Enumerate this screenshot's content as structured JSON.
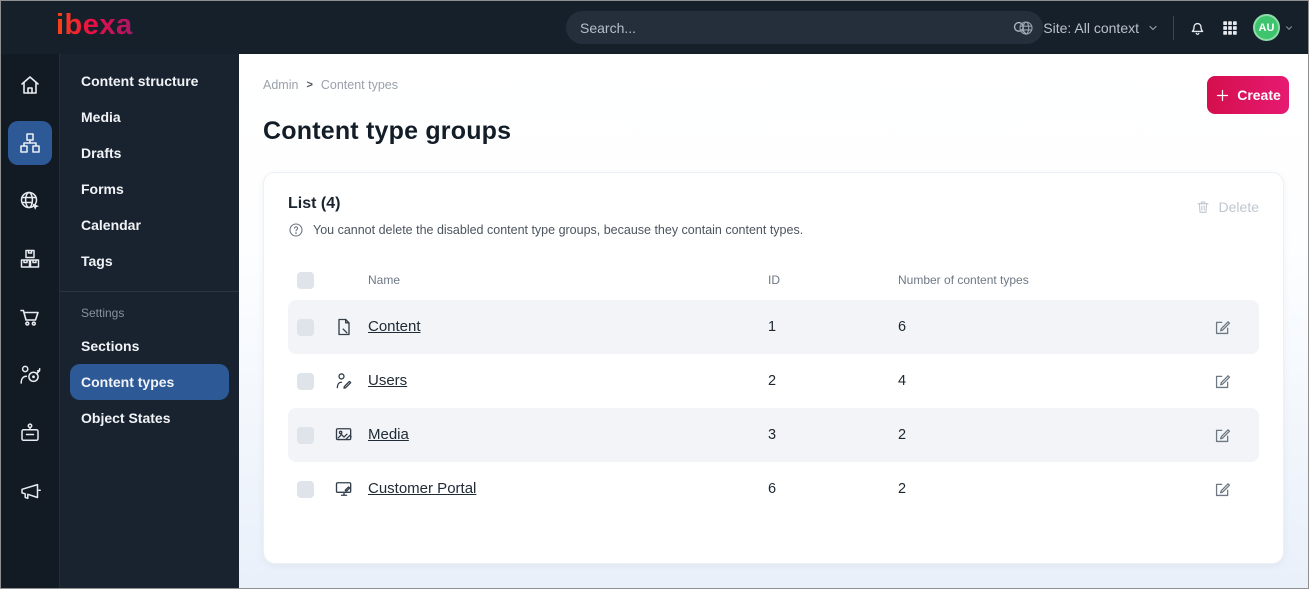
{
  "topbar": {
    "logo_text": "ibexa",
    "search": {
      "placeholder": "Search...",
      "icon": "search-icon"
    },
    "site_selector": {
      "label": "Site: All context",
      "icon": "globe-icon"
    },
    "user_menu": {
      "initials": "AU"
    }
  },
  "sidebar": {
    "rail": [
      {
        "icon": "home-icon",
        "active": false
      },
      {
        "icon": "content-structure-icon",
        "active": true
      },
      {
        "icon": "site-globe-icon",
        "active": false
      },
      {
        "icon": "product-boxes-icon",
        "active": false
      },
      {
        "icon": "cart-icon",
        "active": false
      },
      {
        "icon": "audience-target-icon",
        "active": false
      },
      {
        "icon": "admin-briefcase-icon",
        "active": false
      },
      {
        "icon": "megaphone-icon",
        "active": false
      }
    ],
    "menu": [
      {
        "label": "Content structure"
      },
      {
        "label": "Media"
      },
      {
        "label": "Drafts"
      },
      {
        "label": "Forms"
      },
      {
        "label": "Calendar"
      },
      {
        "label": "Tags"
      }
    ],
    "settings_heading": "Settings",
    "settings_menu": [
      {
        "label": "Sections",
        "active": false
      },
      {
        "label": "Content types",
        "active": true
      },
      {
        "label": "Object States",
        "active": false
      }
    ]
  },
  "main": {
    "breadcrumb": {
      "items": [
        "Admin",
        "Content types"
      ],
      "separator": ">"
    },
    "create_button": "Create",
    "page_title": "Content type groups",
    "list_card": {
      "title": "List (4)",
      "note": "You cannot delete the disabled content type groups, because they contain content types.",
      "delete_button": "Delete",
      "columns": {
        "name": "Name",
        "id": "ID",
        "count": "Number of content types"
      },
      "rows": [
        {
          "icon": "content-file-icon",
          "name": "Content",
          "id": "1",
          "count": "6"
        },
        {
          "icon": "users-person-icon",
          "name": "Users",
          "id": "2",
          "count": "4"
        },
        {
          "icon": "media-image-icon",
          "name": "Media",
          "id": "3",
          "count": "2"
        },
        {
          "icon": "customer-portal-monitor-icon",
          "name": "Customer Portal",
          "id": "6",
          "count": "2"
        }
      ]
    }
  },
  "colors": {
    "topbar_bg": "#16202b",
    "rail_bg": "#121a24",
    "menu_bg": "#19232f",
    "active_blue": "#2d5a97",
    "create_gradient_start": "#d40f4d",
    "create_gradient_end": "#e61a72",
    "logo_gradient_start": "#ff4713",
    "logo_gradient_end": "#aa1668",
    "avatar_green": "#3ec46d",
    "row_stripe": "#f2f4f7",
    "link_text": "#212b36"
  }
}
